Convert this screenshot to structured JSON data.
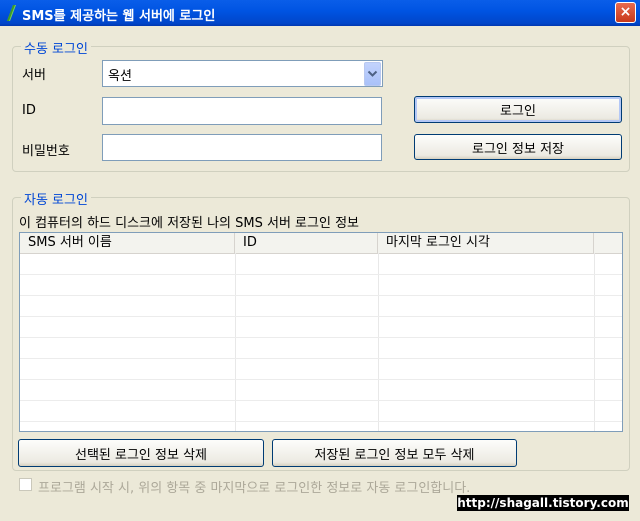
{
  "window": {
    "title": "SMS를 제공하는 웹 서버에 로그인",
    "close_glyph": "×"
  },
  "manual": {
    "title": "수동 로그인",
    "server_label": "서버",
    "server_value": "옥션",
    "id_label": "ID",
    "id_value": "",
    "password_label": "비밀번호",
    "password_value": "",
    "login_button": "로그인",
    "save_button": "로그인 정보 저장"
  },
  "auto": {
    "title": "자동 로그인",
    "description": "이 컴퓨터의 하드 디스크에 저장된 나의 SMS 서버 로그인 정보",
    "columns": [
      "SMS 서버 이름",
      "ID",
      "마지막 로그인 시각"
    ],
    "rows": [],
    "delete_selected_button": "선택된 로그인 정보 삭제",
    "delete_all_button": "저장된 로그인 정보 모두 삭제"
  },
  "auto_login_checkbox": {
    "label": "프로그램 시작 시, 위의 항목 중 마지막으로 로그인한 정보로 자동 로그인합니다.",
    "checked": false,
    "enabled": false
  },
  "watermark": "http://shagall.tistory.com",
  "colors": {
    "title_bar": "#0054e3",
    "group_title": "#0046d5",
    "background": "#ece9d8"
  }
}
